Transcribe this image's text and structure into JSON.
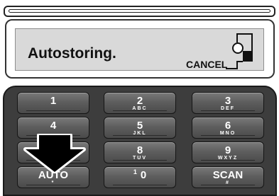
{
  "screen": {
    "title": "Autostoring.",
    "cancel_label": "CANCEL"
  },
  "keypad": {
    "keys": [
      {
        "main": "1",
        "sub": ""
      },
      {
        "main": "2",
        "sub": "ABC"
      },
      {
        "main": "3",
        "sub": "DEF"
      },
      {
        "main": "4",
        "sub": ""
      },
      {
        "main": "5",
        "sub": "JKL"
      },
      {
        "main": "6",
        "sub": "MNO"
      },
      {
        "main": "",
        "sub": ""
      },
      {
        "main": "8",
        "sub": "TUV"
      },
      {
        "main": "9",
        "sub": "WXYZ"
      },
      {
        "main": "AUTO",
        "sub": "*"
      },
      {
        "main": "0",
        "sup": "1",
        "sub": ""
      },
      {
        "main": "SCAN",
        "sub": "#"
      }
    ]
  },
  "icons": {
    "cancel": "cancel-bracket-icon",
    "pointer": "down-arrow-icon"
  },
  "colors": {
    "screen_bg": "#d9d9d9",
    "keypad_bg": "#3d3d3d",
    "key_face": "#5e5e5e"
  }
}
